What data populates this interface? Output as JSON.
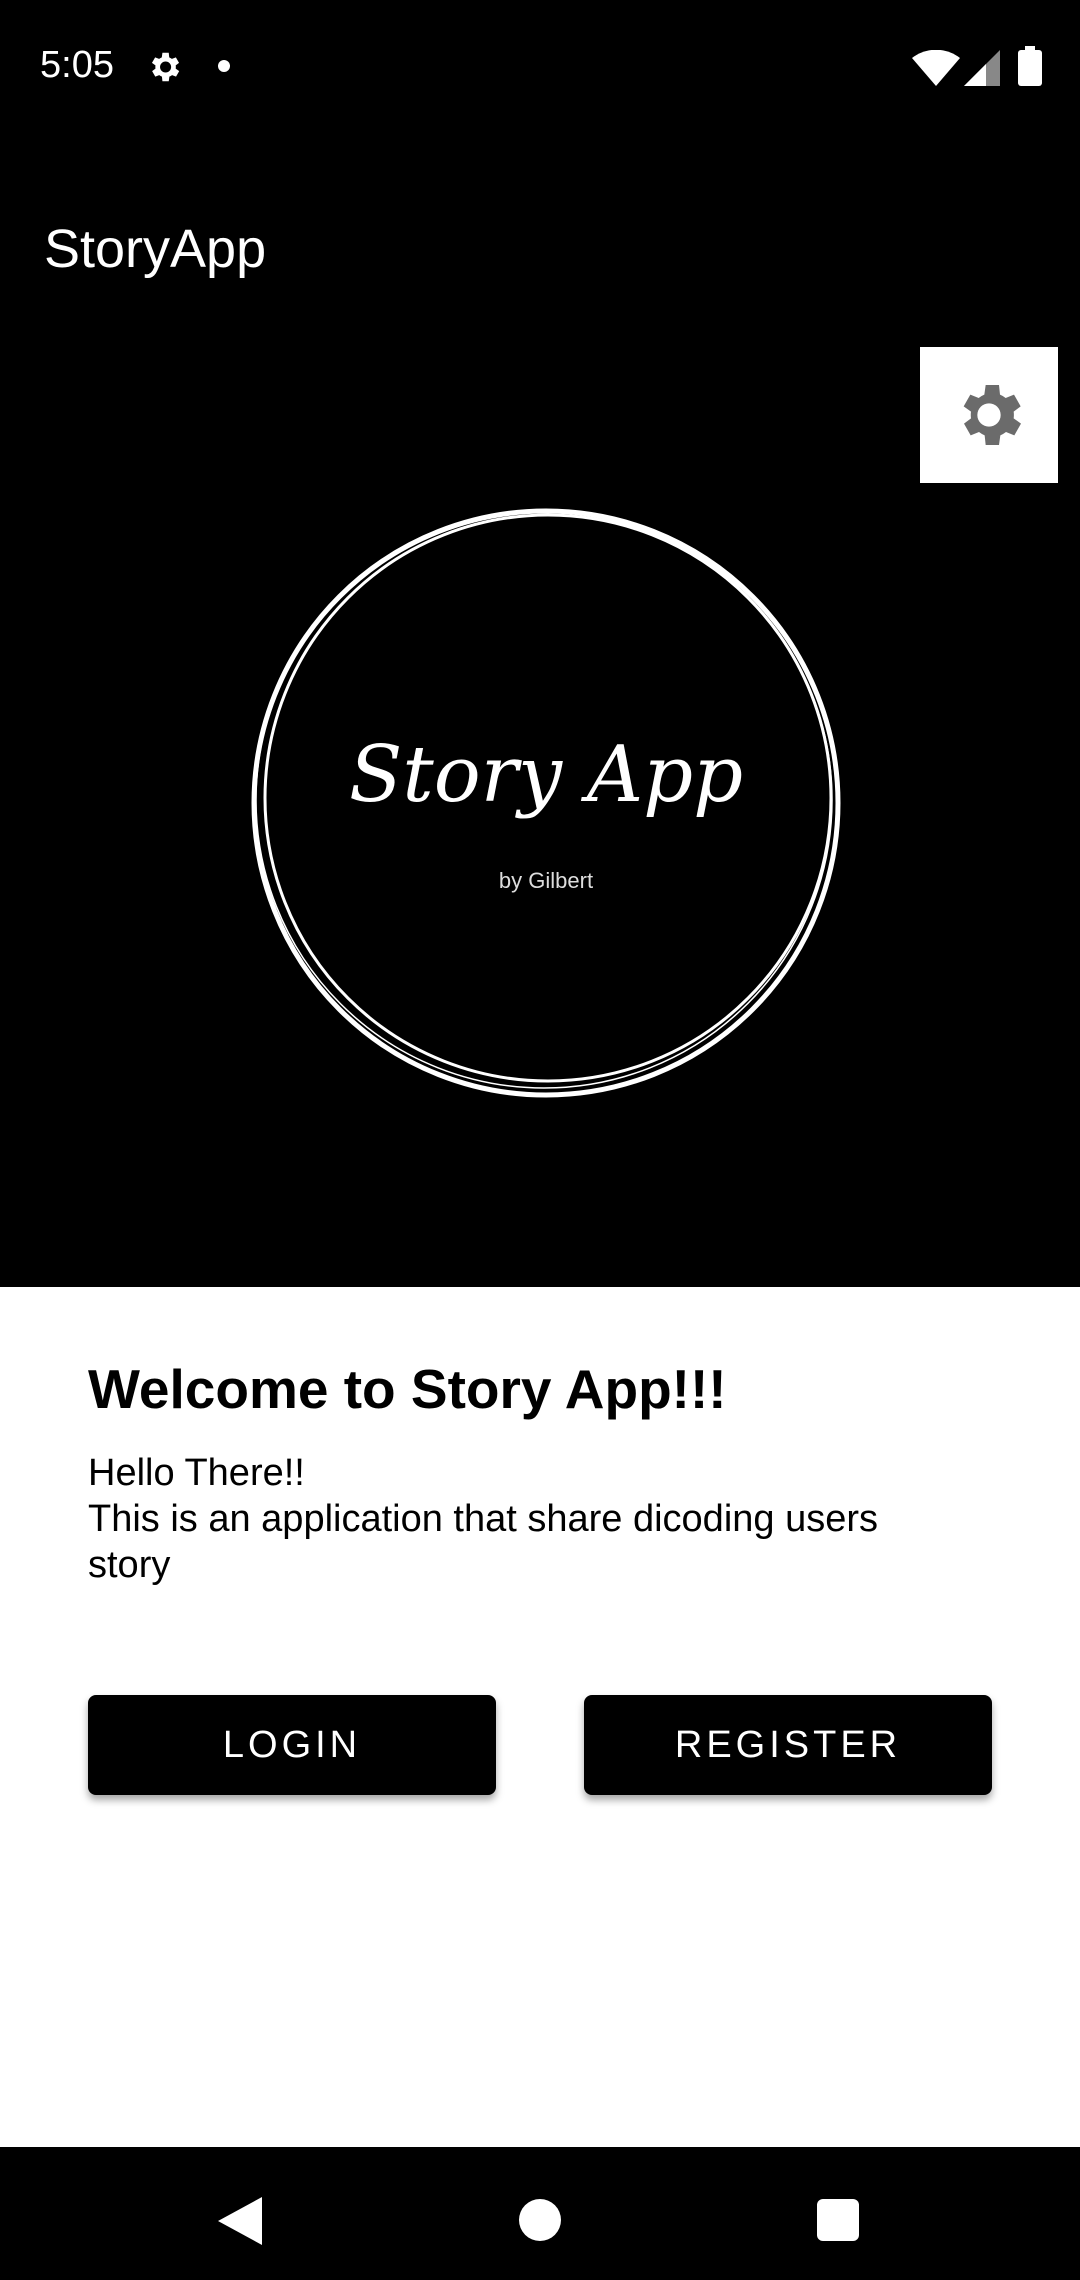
{
  "status_bar": {
    "time": "5:05",
    "icons": [
      "gear-icon",
      "notification-dot",
      "wifi-icon",
      "signal-icon",
      "battery-icon"
    ]
  },
  "app_bar": {
    "title": "StoryApp",
    "settings_icon": "gear-icon"
  },
  "logo": {
    "title": "Story App",
    "subtitle": "by Gilbert"
  },
  "welcome": {
    "title": "Welcome to Story App!!!",
    "line1": "Hello There!!",
    "line2": "This is an application that share dicoding users story"
  },
  "buttons": {
    "login": "LOGIN",
    "register": "REGISTER"
  },
  "nav_bar": {
    "icons": [
      "back-icon",
      "home-icon",
      "recents-icon"
    ]
  },
  "colors": {
    "background": "#000000",
    "sheet": "#FFFFFF",
    "button": "#000000",
    "button_text": "#FFFFFF"
  }
}
